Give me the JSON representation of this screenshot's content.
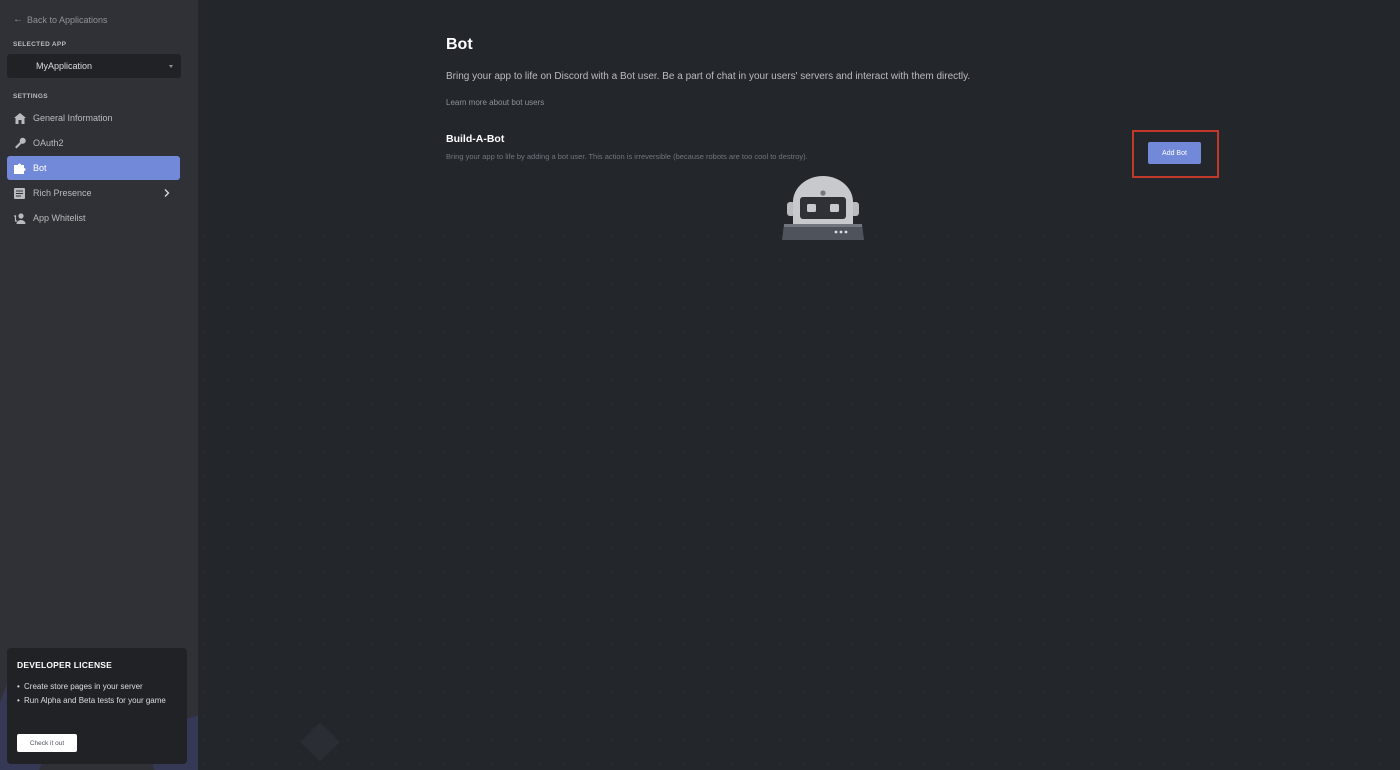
{
  "sidebar": {
    "back_label": "Back to Applications",
    "selected_app_label": "SELECTED APP",
    "app_name": "MyApplication",
    "settings_label": "SETTINGS",
    "items": [
      {
        "label": "General Information",
        "icon": "home-icon"
      },
      {
        "label": "OAuth2",
        "icon": "wrench-icon"
      },
      {
        "label": "Bot",
        "icon": "puzzle-icon",
        "active": true
      },
      {
        "label": "Rich Presence",
        "icon": "document-icon",
        "has_chevron": true
      },
      {
        "label": "App Whitelist",
        "icon": "person-icon"
      }
    ],
    "license": {
      "title": "DEVELOPER LICENSE",
      "bullets": [
        "Create store pages in your server",
        "Run Alpha and Beta tests for your game"
      ],
      "button_label": "Check it out"
    }
  },
  "main": {
    "title": "Bot",
    "description": "Bring your app to life on Discord with a Bot user. Be a part of chat in your users' servers and interact with them directly.",
    "learn_more": "Learn more about bot users",
    "section": {
      "title": "Build-A-Bot",
      "description": "Bring your app to life by adding a bot user. This action is irreversible (because robots are too cool to destroy).",
      "button_label": "Add Bot"
    }
  },
  "colors": {
    "accent": "#7289da",
    "sidebar_bg": "#2f3136",
    "main_bg": "#23262b",
    "highlight": "#c0392b"
  }
}
